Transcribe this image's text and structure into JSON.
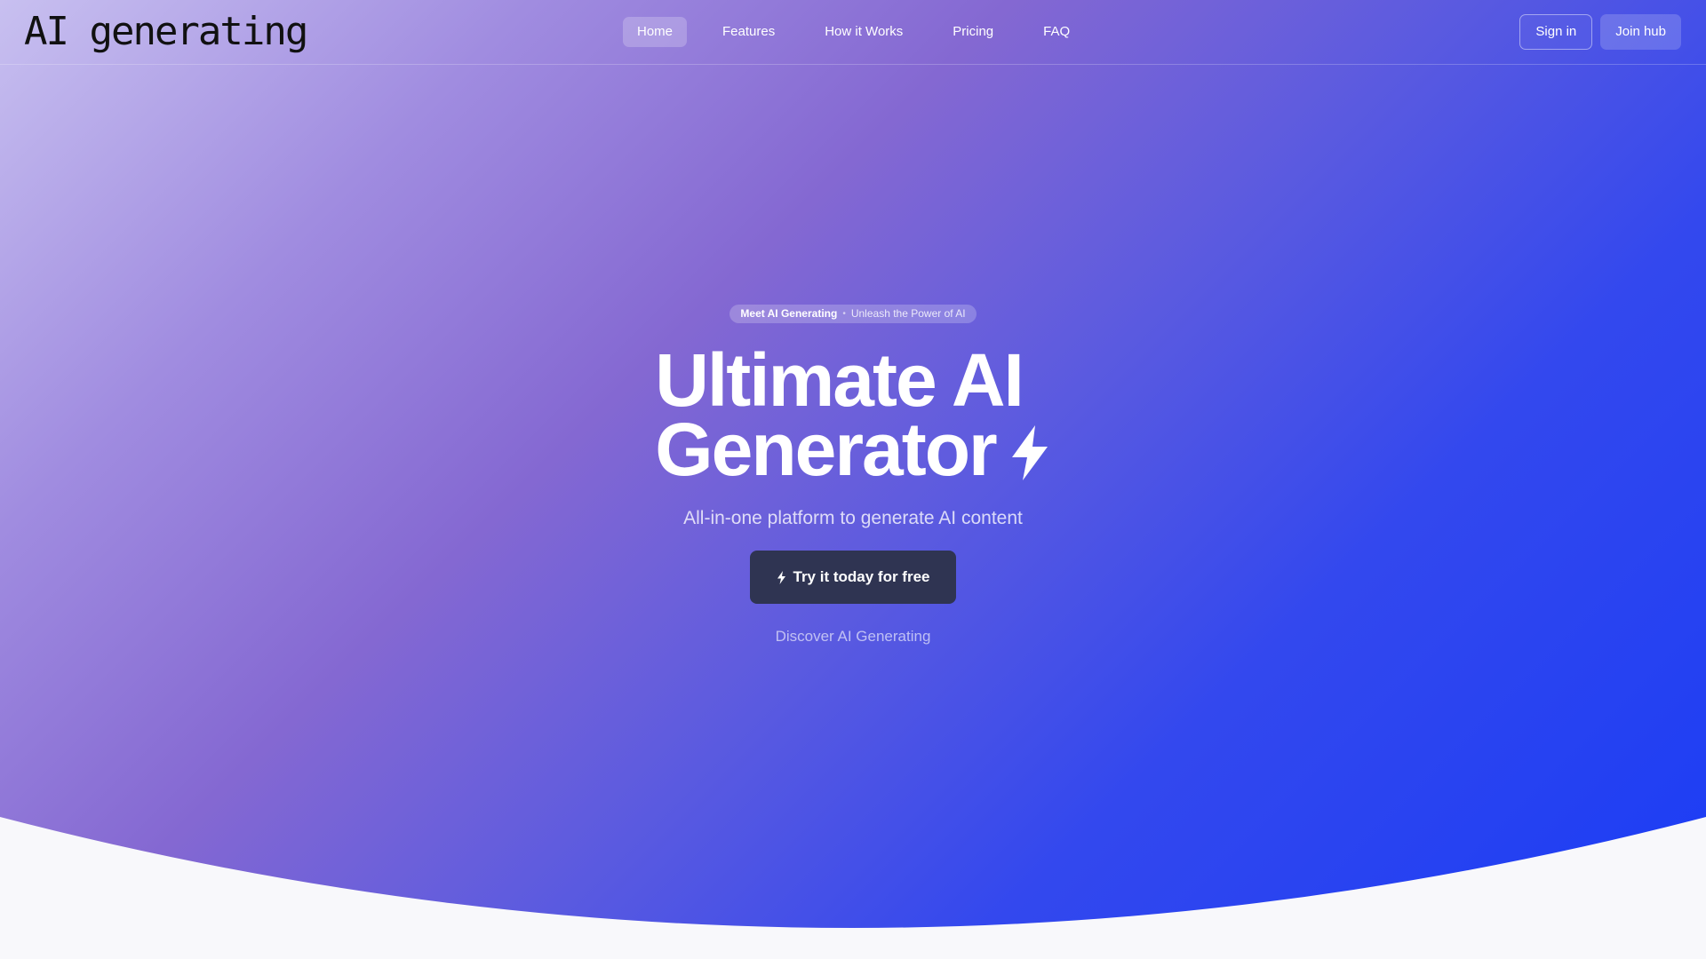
{
  "header": {
    "logo": "AI generating",
    "nav": [
      {
        "label": "Home",
        "active": true
      },
      {
        "label": "Features",
        "active": false
      },
      {
        "label": "How it Works",
        "active": false
      },
      {
        "label": "Pricing",
        "active": false
      },
      {
        "label": "FAQ",
        "active": false
      }
    ],
    "sign_in": "Sign in",
    "join_hub": "Join hub"
  },
  "hero": {
    "badge_title": "Meet AI Generating",
    "badge_separator": "•",
    "badge_text": "Unleash the Power of AI",
    "headline_line1": "Ultimate AI",
    "headline_line2": "Generator",
    "headline_icon": "lightning-bolt-icon",
    "subtitle": "All-in-one platform to generate AI content",
    "cta_label": "Try it today for free",
    "cta_icon": "lightning-bolt-icon",
    "discover_label": "Discover AI Generating"
  },
  "colors": {
    "gradient_start": "#c8c0f0",
    "gradient_mid": "#8468d2",
    "gradient_end": "#1a3cf5",
    "cta_background": "#2f3452",
    "page_background": "#f8f8fb"
  }
}
